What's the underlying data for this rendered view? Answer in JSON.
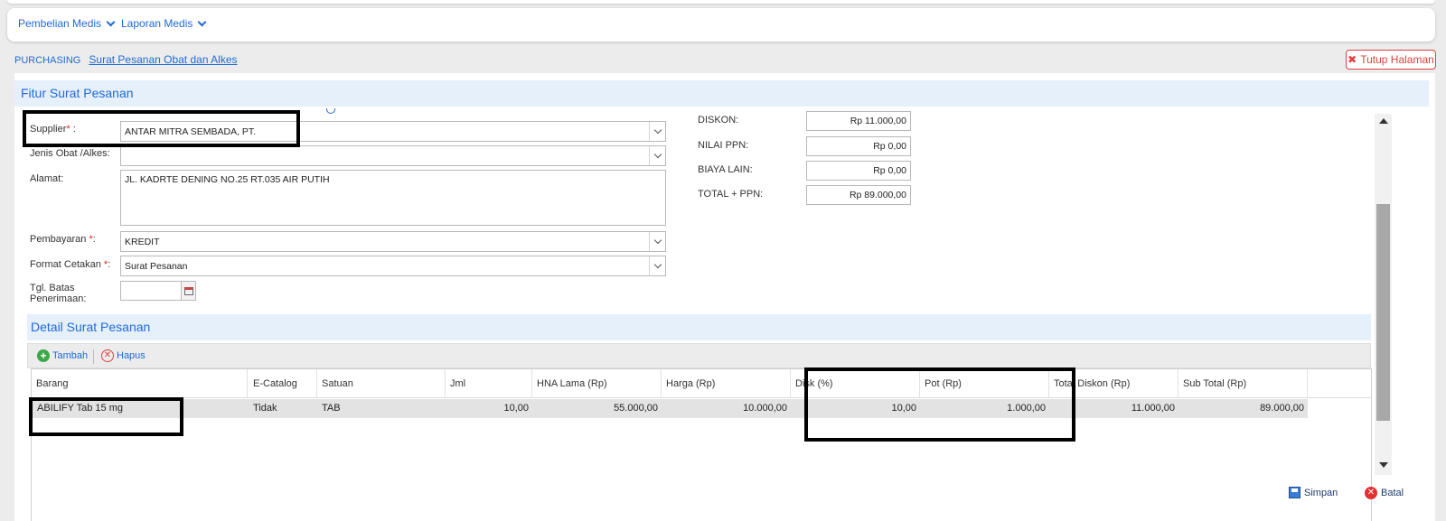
{
  "menu": {
    "items": [
      {
        "label": "Pembelian Medis"
      },
      {
        "label": "Laporan Medis"
      }
    ]
  },
  "breadcrumb": {
    "root": "PURCHASING",
    "current": "Surat Pesanan Obat dan Alkes"
  },
  "close_page_label": "Tutup Halaman",
  "panel_title": "Fitur Surat Pesanan",
  "form": {
    "supplier": {
      "label": "Supplier",
      "req": "*",
      "suffix": " :",
      "value": "ANTAR MITRA SEMBADA, PT."
    },
    "jenis": {
      "label": "Jenis Obat /Alkes:",
      "value": ""
    },
    "alamat": {
      "label": "Alamat:",
      "value": "JL. KADRTE DENING NO.25 RT.035 AIR PUTIH"
    },
    "pembayaran": {
      "label": "Pembayaran ",
      "req": "*",
      "suffix": ":",
      "value": "KREDIT"
    },
    "format_cetakan": {
      "label": "Format Cetakan ",
      "req": "*",
      "suffix": ":",
      "value": "Surat Pesanan"
    },
    "tgl_batas": {
      "label_line1": "Tgl. Batas",
      "label_line2": "Penerimaan:",
      "value": ""
    }
  },
  "summary": {
    "diskon": {
      "label": "DISKON:",
      "value": "Rp 11.000,00"
    },
    "nilai_ppn": {
      "label": "NILAI PPN:",
      "value": "Rp 0,00"
    },
    "biaya_lain": {
      "label": "BIAYA LAIN:",
      "value": "Rp 0,00"
    },
    "total_ppn": {
      "label": "TOTAL + PPN:",
      "value": "Rp 89.000,00"
    }
  },
  "detail": {
    "title": "Detail Surat Pesanan",
    "add_label": "Tambah",
    "delete_label": "Hapus",
    "columns": [
      "Barang",
      "E-Catalog",
      "Satuan",
      "Jml",
      "HNA Lama (Rp)",
      "Harga (Rp)",
      "Disk (%)",
      "Pot (Rp)",
      "Total Diskon (Rp)",
      "Sub Total (Rp)"
    ],
    "rows": [
      {
        "barang": "ABILIFY Tab 15 mg",
        "ecatalog": "Tidak",
        "satuan": "TAB",
        "jml": "10,00",
        "hna_lama": "55.000,00",
        "harga": "10.000,00",
        "disk": "10,00",
        "pot": "1.000,00",
        "total_diskon": "11.000,00",
        "sub_total": "89.000,00"
      }
    ]
  },
  "footer": {
    "save_label": "Simpan",
    "cancel_label": "Batal"
  },
  "colors": {
    "accent": "#1f6ad6",
    "danger": "#e04040",
    "header_bg": "#e6f0fb"
  }
}
